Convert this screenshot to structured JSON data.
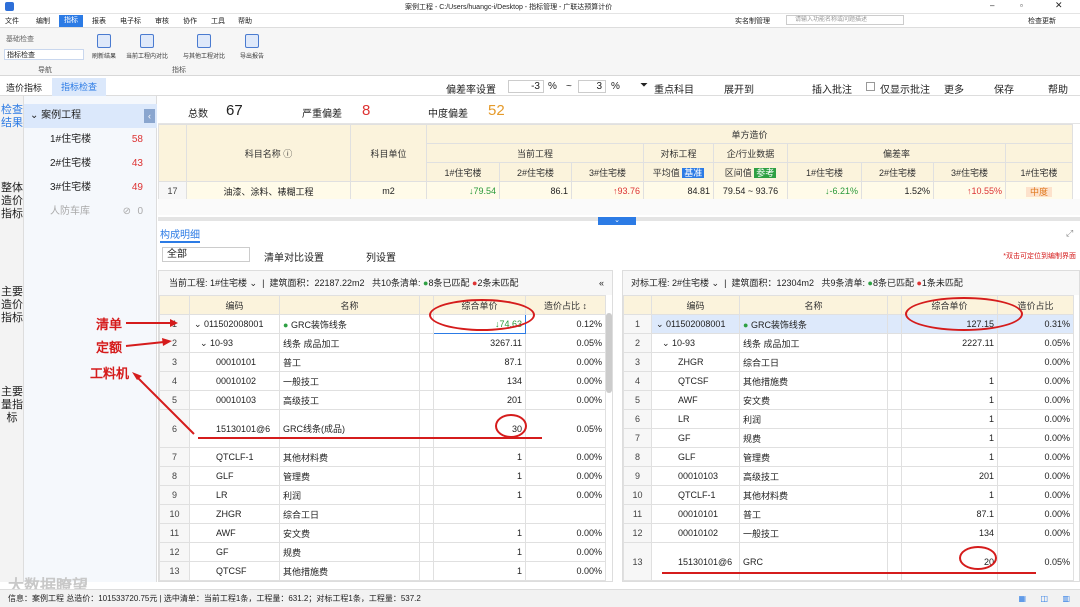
{
  "window": {
    "title": "案例工程 - C:/Users/huangc-i/Desktop - 指标管理 - 广联达预算计价",
    "realname": "实名制管理",
    "search_placeholder": "请输入功能名称或问题描述",
    "check_update": "检查更新"
  },
  "menu": [
    "文件",
    "编制",
    "指标",
    "报表",
    "电子标",
    "审核",
    "协作",
    "工具",
    "帮助"
  ],
  "ribbon": {
    "nav_items": [
      "基础检查",
      "指标检查"
    ],
    "nav_group": "导航",
    "buttons": [
      "刷新结果",
      "当前工程内对比",
      "与其他工程对比",
      "导出报告"
    ],
    "group": "指标"
  },
  "tabs": [
    "造价指标",
    "指标检查"
  ],
  "toolbar": {
    "dev_label": "偏差率设置",
    "dev_min": "-3",
    "pct": "%",
    "tilde": "~",
    "dev_max": "3",
    "key_subject": "重点科目",
    "expand": "展开到",
    "insert_note": "插入批注",
    "only_note": "仅显示批注",
    "more": "更多",
    "save": "保存",
    "help": "帮助"
  },
  "left_tabs": [
    "检查结果",
    "整体造价指标",
    "主要造价指标",
    "主要量指标"
  ],
  "tree": {
    "root": "案例工程",
    "items": [
      {
        "name": "1#住宅楼",
        "count": "58"
      },
      {
        "name": "2#住宅楼",
        "count": "43"
      },
      {
        "name": "3#住宅楼",
        "count": "49"
      },
      {
        "name": "人防车库",
        "count": "0"
      }
    ]
  },
  "summary": {
    "total_label": "总数",
    "total": "67",
    "severe_label": "严重偏差",
    "severe": "8",
    "mid_label": "中度偏差",
    "mid": "52"
  },
  "top_headers": {
    "unit_cost": "单方造价",
    "subject": "科目名称",
    "subject_unit": "科目单位",
    "current": "当前工程",
    "benchmark": "对标工程",
    "industry": "企/行业数据",
    "dev": "偏差率",
    "b1": "1#住宅楼",
    "b2": "2#住宅楼",
    "b3": "3#住宅楼",
    "avg": "平均值",
    "base": "基准",
    "range": "区间值",
    "ref": "参考",
    "c1": "1#住宅楼",
    "c2": "2#住宅楼",
    "c3": "3#住宅楼",
    "c4": "1#住宅楼"
  },
  "top_row": {
    "no": "17",
    "name": "油漆、涂料、裱糊工程",
    "unit": "m2",
    "v1": "79.54",
    "v2": "86.1",
    "v3": "93.76",
    "avg": "84.81",
    "range": "79.54 ~ 93.76",
    "d1": "-6.21%",
    "d2": "1.52%",
    "d3": "10.55%",
    "level": "中度"
  },
  "section_title": "构成明细",
  "filter": {
    "all": "全部",
    "compare": "清单对比设置",
    "cols": "列设置",
    "hint": "*双击可定位到编制界面"
  },
  "left_panel": {
    "cur_label": "当前工程:",
    "cur_proj": "1#住宅楼",
    "area": "建筑面积：22187.22m2",
    "lists": "共10条清单:",
    "matched": "8条已匹配",
    "unmatched": "2条未匹配",
    "col_code": "编码",
    "col_name": "名称",
    "col_price": "综合单价",
    "col_share": "造价占比"
  },
  "left_rows": [
    {
      "no": "1",
      "code": "011502008001",
      "name": "GRC装饰线条",
      "price": "74.63",
      "share": "0.12%"
    },
    {
      "no": "2",
      "code": "10-93",
      "name": "线条 成品加工",
      "price": "3267.11",
      "share": "0.05%"
    },
    {
      "no": "3",
      "code": "00010101",
      "name": "普工",
      "price": "87.1",
      "share": "0.00%"
    },
    {
      "no": "4",
      "code": "00010102",
      "name": "一般技工",
      "price": "134",
      "share": "0.00%"
    },
    {
      "no": "5",
      "code": "00010103",
      "name": "高级技工",
      "price": "201",
      "share": "0.00%"
    },
    {
      "no": "6",
      "code": "15130101@6",
      "name": "GRC线条(成品)",
      "price": "30",
      "share": "0.05%"
    },
    {
      "no": "7",
      "code": "QTCLF-1",
      "name": "其他材料费",
      "price": "1",
      "share": "0.00%"
    },
    {
      "no": "8",
      "code": "GLF",
      "name": "管理费",
      "price": "1",
      "share": "0.00%"
    },
    {
      "no": "9",
      "code": "LR",
      "name": "利润",
      "price": "1",
      "share": "0.00%"
    },
    {
      "no": "10",
      "code": "ZHGR",
      "name": "综合工日",
      "price": "",
      "share": ""
    },
    {
      "no": "11",
      "code": "AWF",
      "name": "安文费",
      "price": "1",
      "share": "0.00%"
    },
    {
      "no": "12",
      "code": "GF",
      "name": "规费",
      "price": "1",
      "share": "0.00%"
    },
    {
      "no": "13",
      "code": "QTCSF",
      "name": "其他措施费",
      "price": "1",
      "share": "0.00%"
    }
  ],
  "right_panel": {
    "bm_label": "对标工程:",
    "bm_proj": "2#住宅楼",
    "area": "建筑面积：12304m2",
    "lists": "共9条清单:",
    "matched": "8条已匹配",
    "unmatched": "1条未匹配",
    "col_code": "编码",
    "col_name": "名称",
    "col_price": "综合单价",
    "col_share": "造价占比"
  },
  "right_rows": [
    {
      "no": "1",
      "code": "011502008001",
      "name": "GRC装饰线条",
      "price": "127.15",
      "share": "0.31%"
    },
    {
      "no": "2",
      "code": "10-93",
      "name": "线条 成品加工",
      "price": "2227.11",
      "share": "0.05%"
    },
    {
      "no": "3",
      "code": "ZHGR",
      "name": "综合工日",
      "price": "",
      "share": "0.00%"
    },
    {
      "no": "4",
      "code": "QTCSF",
      "name": "其他措施费",
      "price": "1",
      "share": "0.00%"
    },
    {
      "no": "5",
      "code": "AWF",
      "name": "安文费",
      "price": "1",
      "share": "0.00%"
    },
    {
      "no": "6",
      "code": "LR",
      "name": "利润",
      "price": "1",
      "share": "0.00%"
    },
    {
      "no": "7",
      "code": "GF",
      "name": "规费",
      "price": "1",
      "share": "0.00%"
    },
    {
      "no": "8",
      "code": "GLF",
      "name": "管理费",
      "price": "1",
      "share": "0.00%"
    },
    {
      "no": "9",
      "code": "00010103",
      "name": "高级技工",
      "price": "201",
      "share": "0.00%"
    },
    {
      "no": "10",
      "code": "QTCLF-1",
      "name": "其他材料费",
      "price": "1",
      "share": "0.00%"
    },
    {
      "no": "11",
      "code": "00010101",
      "name": "普工",
      "price": "87.1",
      "share": "0.00%"
    },
    {
      "no": "12",
      "code": "00010102",
      "name": "一般技工",
      "price": "134",
      "share": "0.00%"
    },
    {
      "no": "13",
      "code": "15130101@6",
      "name": "GRC",
      "price": "20",
      "share": "0.05%"
    }
  ],
  "annotations": {
    "qingdan": "清单",
    "dinge": "定额",
    "gongliaoji": "工料机"
  },
  "status": {
    "text": "信息：案例工程  总造价：101533720.75元 | 选中清单：当前工程1条，工程量：631.2；对标工程1条，工程量：537.2"
  },
  "watermark": "大数据瞭望",
  "colors": {
    "accent": "#2c7be5",
    "red": "#d51c1c",
    "header_bg": "#fbf3dc"
  }
}
